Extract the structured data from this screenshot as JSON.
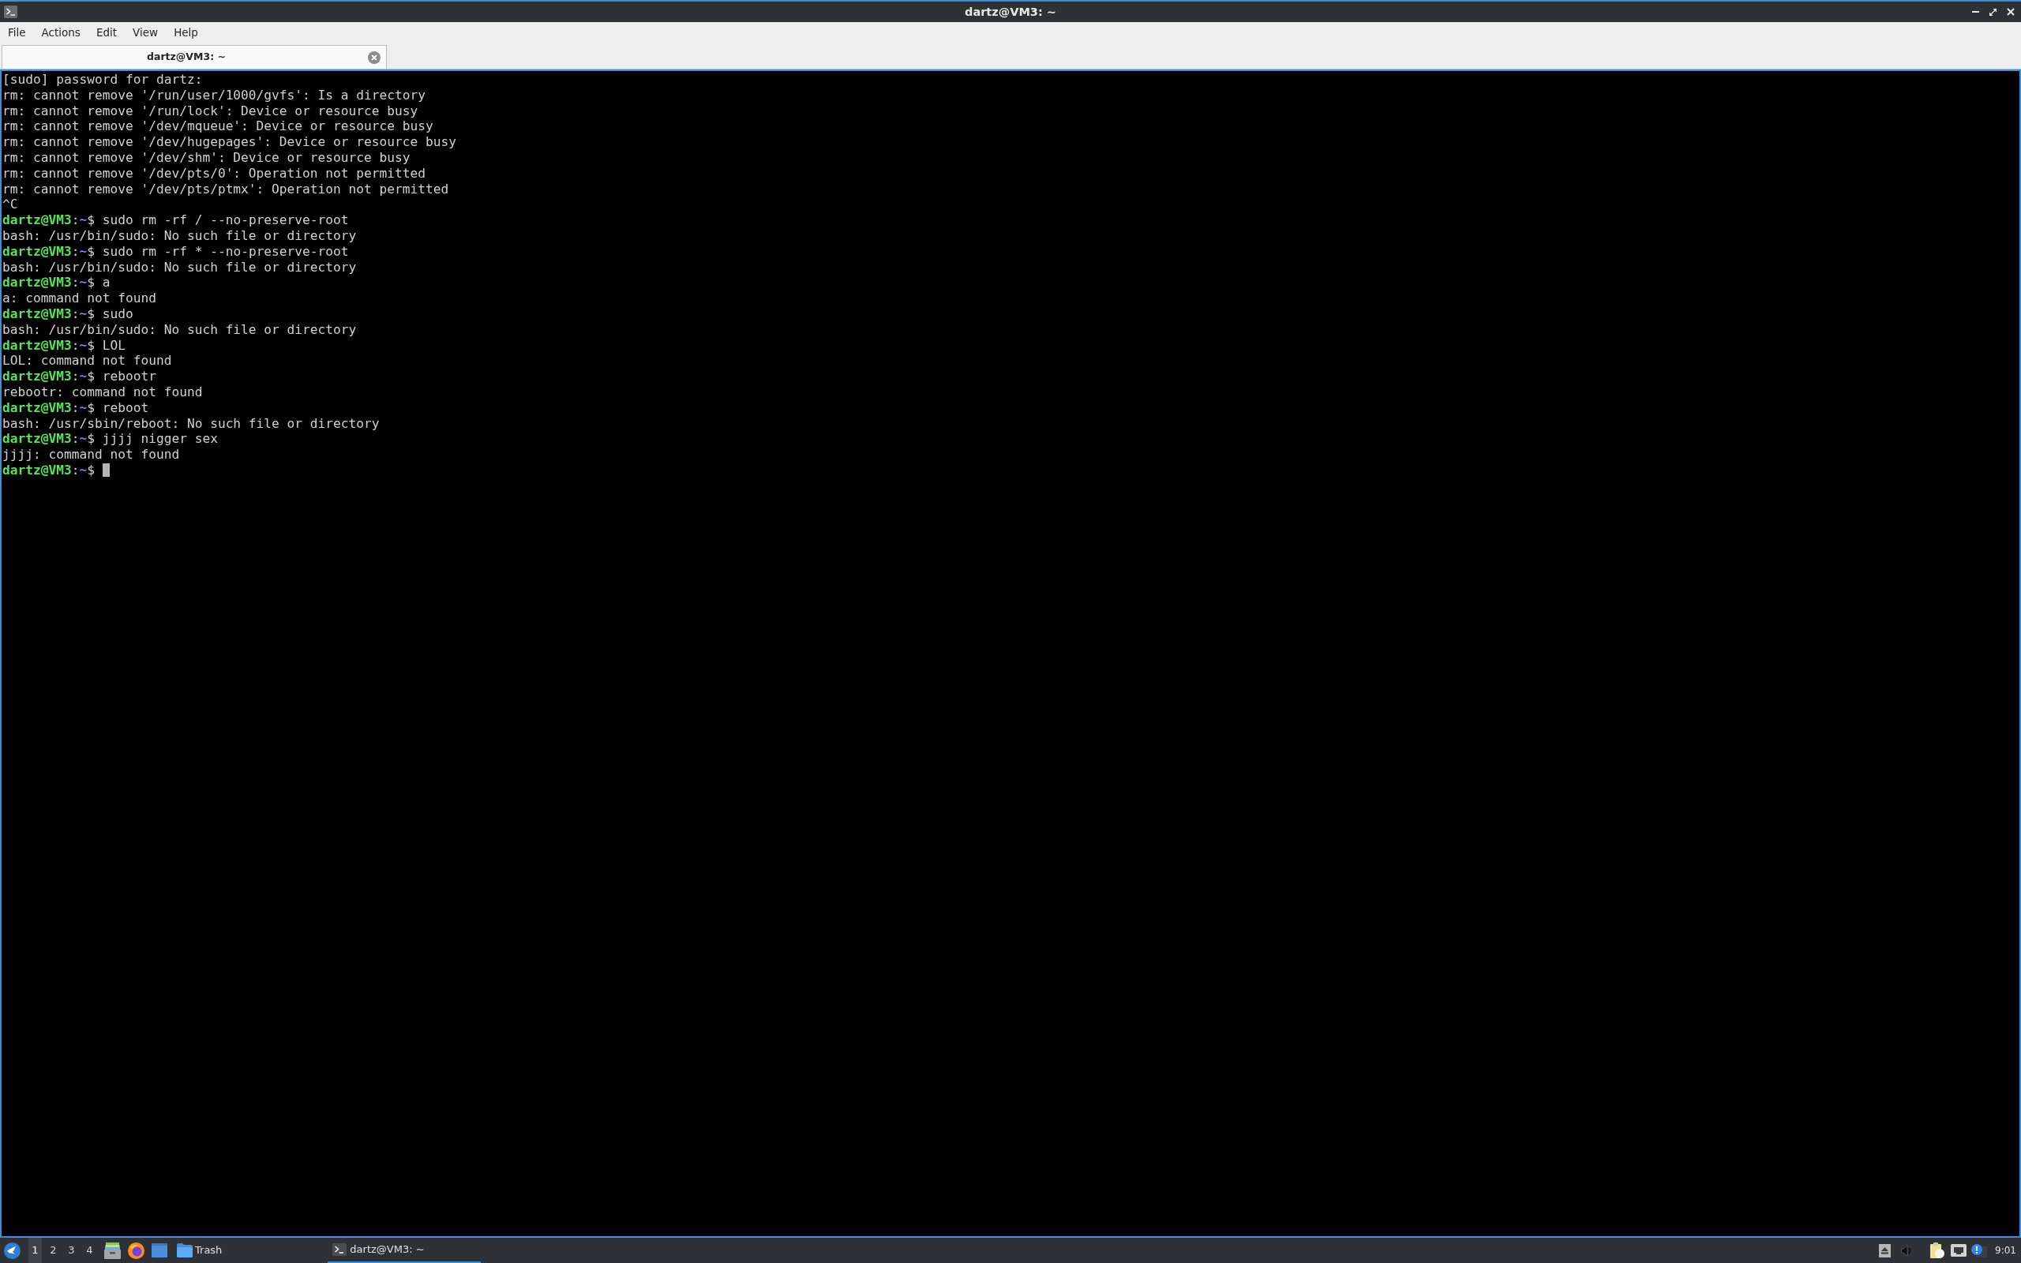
{
  "window": {
    "title": "dartz@VM3: ~"
  },
  "menu": [
    {
      "label": "File"
    },
    {
      "label": "Actions"
    },
    {
      "label": "Edit"
    },
    {
      "label": "View"
    },
    {
      "label": "Help"
    }
  ],
  "tabs": [
    {
      "label": "dartz@VM3: ~",
      "selected": true
    }
  ],
  "terminal": {
    "lines": [
      {
        "kind": "output",
        "text": "[sudo] password for dartz:"
      },
      {
        "kind": "output",
        "text": "rm: cannot remove '/run/user/1000/gvfs': Is a directory"
      },
      {
        "kind": "output",
        "text": "rm: cannot remove '/run/lock': Device or resource busy"
      },
      {
        "kind": "output",
        "text": "rm: cannot remove '/dev/mqueue': Device or resource busy"
      },
      {
        "kind": "output",
        "text": "rm: cannot remove '/dev/hugepages': Device or resource busy"
      },
      {
        "kind": "output",
        "text": "rm: cannot remove '/dev/shm': Device or resource busy"
      },
      {
        "kind": "output",
        "text": "rm: cannot remove '/dev/pts/0': Operation not permitted"
      },
      {
        "kind": "output",
        "text": "rm: cannot remove '/dev/pts/ptmx': Operation not permitted"
      },
      {
        "kind": "output",
        "text": "^C"
      },
      {
        "kind": "prompt",
        "user": "dartz@VM3",
        "separator": ":",
        "path": "~",
        "symbol": "$",
        "command": "sudo rm -rf / --no-preserve-root"
      },
      {
        "kind": "output",
        "text": "bash: /usr/bin/sudo: No such file or directory"
      },
      {
        "kind": "prompt",
        "user": "dartz@VM3",
        "separator": ":",
        "path": "~",
        "symbol": "$",
        "command": "sudo rm -rf * --no-preserve-root"
      },
      {
        "kind": "output",
        "text": "bash: /usr/bin/sudo: No such file or directory"
      },
      {
        "kind": "prompt",
        "user": "dartz@VM3",
        "separator": ":",
        "path": "~",
        "symbol": "$",
        "command": "a"
      },
      {
        "kind": "output",
        "text": "a: command not found"
      },
      {
        "kind": "prompt",
        "user": "dartz@VM3",
        "separator": ":",
        "path": "~",
        "symbol": "$",
        "command": "sudo"
      },
      {
        "kind": "output",
        "text": "bash: /usr/bin/sudo: No such file or directory"
      },
      {
        "kind": "prompt",
        "user": "dartz@VM3",
        "separator": ":",
        "path": "~",
        "symbol": "$",
        "command": "LOL"
      },
      {
        "kind": "output",
        "text": "LOL: command not found"
      },
      {
        "kind": "prompt",
        "user": "dartz@VM3",
        "separator": ":",
        "path": "~",
        "symbol": "$",
        "command": "rebootr"
      },
      {
        "kind": "output",
        "text": "rebootr: command not found"
      },
      {
        "kind": "prompt",
        "user": "dartz@VM3",
        "separator": ":",
        "path": "~",
        "symbol": "$",
        "command": "reboot"
      },
      {
        "kind": "output",
        "text": "bash: /usr/sbin/reboot: No such file or directory"
      },
      {
        "kind": "prompt",
        "user": "dartz@VM3",
        "separator": ":",
        "path": "~",
        "symbol": "$",
        "command": "jjjj nigger sex"
      },
      {
        "kind": "output",
        "text": "jjjj: command not found"
      },
      {
        "kind": "prompt",
        "user": "dartz@VM3",
        "separator": ":",
        "path": "~",
        "symbol": "$"
      }
    ],
    "cursor": true
  },
  "taskbar": {
    "workspaces": [
      {
        "label": "1",
        "selected": true
      },
      {
        "label": "2",
        "selected": false
      },
      {
        "label": "3",
        "selected": false
      },
      {
        "label": "4",
        "selected": false
      }
    ],
    "places": [
      {
        "label": "Trash"
      }
    ],
    "tasks": [
      {
        "label": "dartz@VM3: ~",
        "selected": true
      }
    ],
    "clock": "9:01"
  }
}
